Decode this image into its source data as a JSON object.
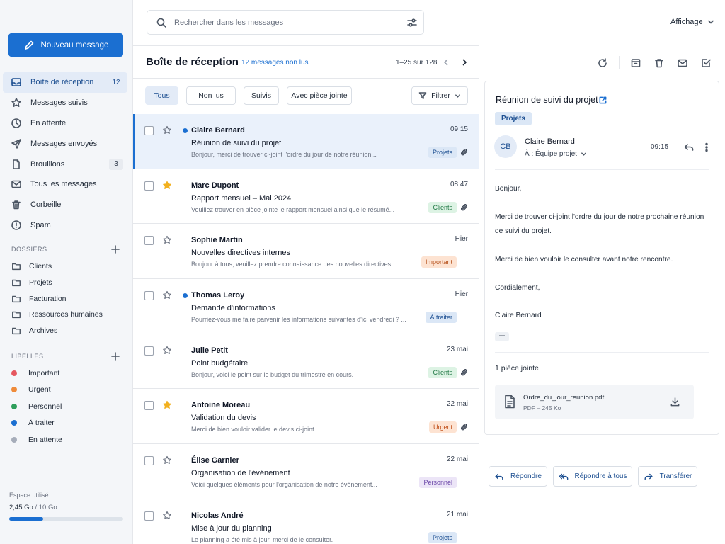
{
  "compose": {
    "label": "Nouveau message"
  },
  "nav": [
    {
      "label": "Boîte de réception",
      "count": "12",
      "icon": "inbox-icon"
    },
    {
      "label": "Messages suivis",
      "count": "",
      "icon": "star-icon"
    },
    {
      "label": "En attente",
      "count": "",
      "icon": "clock-icon"
    },
    {
      "label": "Messages envoyés",
      "count": "",
      "icon": "send-icon"
    },
    {
      "label": "Brouillons",
      "count": "3",
      "icon": "draft-icon"
    },
    {
      "label": "Tous les messages",
      "count": "",
      "icon": "mail-icon"
    },
    {
      "label": "Corbeille",
      "count": "",
      "icon": "trash-icon"
    },
    {
      "label": "Spam",
      "count": "",
      "icon": "alert-icon"
    }
  ],
  "folders": {
    "title": "DOSSIERS",
    "items": [
      "Clients",
      "Projets",
      "Facturation",
      "Ressources humaines",
      "Archives"
    ]
  },
  "labels": {
    "title": "LIBELLÉS",
    "items": [
      {
        "label": "Important",
        "color": "#e5575f"
      },
      {
        "label": "Urgent",
        "color": "#ef8b3a"
      },
      {
        "label": "Personnel",
        "color": "#2e9e5b"
      },
      {
        "label": "À traiter",
        "color": "#1b6fd1"
      },
      {
        "label": "En attente",
        "color": "#a6adba"
      }
    ]
  },
  "storage": {
    "title": "Espace utilisé",
    "used": "2,45 Go",
    "total": "/ 10 Go",
    "fraction": 0.3
  },
  "search": {
    "placeholder": "Rechercher dans les messages"
  },
  "display": {
    "label": "Affichage"
  },
  "list": {
    "title": "Boîte de réception",
    "unread": "12 messages non lus",
    "pager": "1–25 sur 128",
    "chips": [
      "Tous",
      "Non lus",
      "Suivis",
      "Avec pièce jointe"
    ],
    "filter": "Filtrer"
  },
  "tag_styles": {
    "Projets": {
      "bg": "#dbe7f6",
      "fg": "#1d4f91"
    },
    "Clients": {
      "bg": "#ddf3e4",
      "fg": "#237a47"
    },
    "Important": {
      "bg": "#fde3d2",
      "fg": "#b5501a"
    },
    "À traiter": {
      "bg": "#dbe7f6",
      "fg": "#1d4f91"
    },
    "Urgent": {
      "bg": "#fde3d2",
      "fg": "#c2521c"
    },
    "Personnel": {
      "bg": "#ece5f7",
      "fg": "#6b46a8"
    }
  },
  "messages": [
    {
      "sender": "Claire Bernard",
      "subject": "Réunion de suivi du projet",
      "snippet": "Bonjour, merci de trouver ci-joint l'ordre du jour de notre réunion...",
      "time": "09:15",
      "tag": "Projets",
      "attachment": true,
      "starred": false,
      "unread": true,
      "selected": true
    },
    {
      "sender": "Marc Dupont",
      "subject": "Rapport mensuel – Mai 2024",
      "snippet": "Veuillez trouver en pièce jointe le rapport mensuel ainsi que le résumé...",
      "time": "08:47",
      "tag": "Clients",
      "attachment": true,
      "starred": true,
      "unread": false,
      "selected": false
    },
    {
      "sender": "Sophie Martin",
      "subject": "Nouvelles directives internes",
      "snippet": "Bonjour à tous, veuillez prendre connaissance des nouvelles directives...",
      "time": "Hier",
      "tag": "Important",
      "attachment": false,
      "starred": false,
      "unread": false,
      "selected": false
    },
    {
      "sender": "Thomas Leroy",
      "subject": "Demande d'informations",
      "snippet": "Pourriez-vous me faire parvenir les informations suivantes d'ici vendredi ? ...",
      "time": "Hier",
      "tag": "À traiter",
      "attachment": false,
      "starred": false,
      "unread": true,
      "selected": false
    },
    {
      "sender": "Julie Petit",
      "subject": "Point budgétaire",
      "snippet": "Bonjour, voici le point sur le budget du trimestre en cours.",
      "time": "23 mai",
      "tag": "Clients",
      "attachment": true,
      "starred": false,
      "unread": false,
      "selected": false
    },
    {
      "sender": "Antoine Moreau",
      "subject": "Validation du devis",
      "snippet": "Merci de bien vouloir valider le devis ci-joint.",
      "time": "22 mai",
      "tag": "Urgent",
      "attachment": true,
      "starred": true,
      "unread": false,
      "selected": false
    },
    {
      "sender": "Élise Garnier",
      "subject": "Organisation de l'événement",
      "snippet": "Voici quelques éléments pour l'organisation de notre événement...",
      "time": "22 mai",
      "tag": "Personnel",
      "attachment": false,
      "starred": false,
      "unread": false,
      "selected": false
    },
    {
      "sender": "Nicolas André",
      "subject": "Mise à jour du planning",
      "snippet": "Le planning a été mis à jour, merci de le consulter.",
      "time": "21 mai",
      "tag": "Projets",
      "attachment": false,
      "starred": false,
      "unread": false,
      "selected": false
    }
  ],
  "reader": {
    "subject": "Réunion de suivi du projet",
    "tag": "Projets",
    "avatar": "CB",
    "from": "Claire Bernard",
    "to": "À : Équipe projet",
    "time": "09:15",
    "body": [
      "Bonjour,",
      "Merci de trouver ci-joint l'ordre du jour de notre prochaine réunion de suivi du projet.",
      "Merci de bien vouloir le consulter avant notre rencontre.",
      "Cordialement,",
      "Claire Bernard"
    ],
    "ellipsis": "···",
    "attachments_title": "1 pièce jointe",
    "attachment": {
      "name": "Ordre_du_jour_reunion.pdf",
      "meta": "PDF – 245 Ko"
    }
  },
  "actions": {
    "reply": "Répondre",
    "reply_all": "Répondre à tous",
    "forward": "Transférer"
  }
}
